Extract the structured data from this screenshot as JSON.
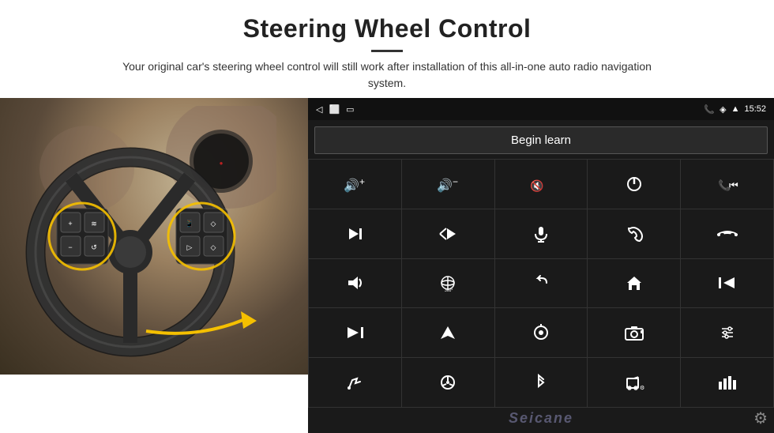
{
  "header": {
    "title": "Steering Wheel Control",
    "subtitle": "Your original car's steering wheel control will still work after installation of this all-in-one auto radio navigation system."
  },
  "status_bar": {
    "back_icon": "◁",
    "home_icon": "⬜",
    "recent_icon": "▭",
    "signal_icon": "▣",
    "phone_icon": "📞",
    "location_icon": "◈",
    "wifi_icon": "▲",
    "time": "15:52"
  },
  "begin_learn": {
    "label": "Begin learn"
  },
  "controls": [
    {
      "icon": "🔊+",
      "label": "vol-up"
    },
    {
      "icon": "🔊−",
      "label": "vol-down"
    },
    {
      "icon": "🔇",
      "label": "mute"
    },
    {
      "icon": "⏻",
      "label": "power"
    },
    {
      "icon": "⏮",
      "label": "prev-track"
    },
    {
      "icon": "⏭",
      "label": "next"
    },
    {
      "icon": "⏸",
      "label": "skip-next"
    },
    {
      "icon": "🎤",
      "label": "mic"
    },
    {
      "icon": "📞",
      "label": "call"
    },
    {
      "icon": "↩",
      "label": "hang-up"
    },
    {
      "icon": "🔔",
      "label": "announce"
    },
    {
      "icon": "🌐",
      "label": "360"
    },
    {
      "icon": "↺",
      "label": "back"
    },
    {
      "icon": "🏠",
      "label": "home"
    },
    {
      "icon": "⏮⏮",
      "label": "rewind"
    },
    {
      "icon": "⏭⏭",
      "label": "fast-forward"
    },
    {
      "icon": "▶",
      "label": "navigate"
    },
    {
      "icon": "⏺",
      "label": "source"
    },
    {
      "icon": "📷",
      "label": "camera"
    },
    {
      "icon": "🎛",
      "label": "equalizer"
    },
    {
      "icon": "✏",
      "label": "draw"
    },
    {
      "icon": "🎯",
      "label": "steering"
    },
    {
      "icon": "✱",
      "label": "bluetooth"
    },
    {
      "icon": "🎵",
      "label": "music"
    },
    {
      "icon": "📊",
      "label": "spectrum"
    }
  ],
  "watermark": "Seicane",
  "gear_icon": "⚙"
}
